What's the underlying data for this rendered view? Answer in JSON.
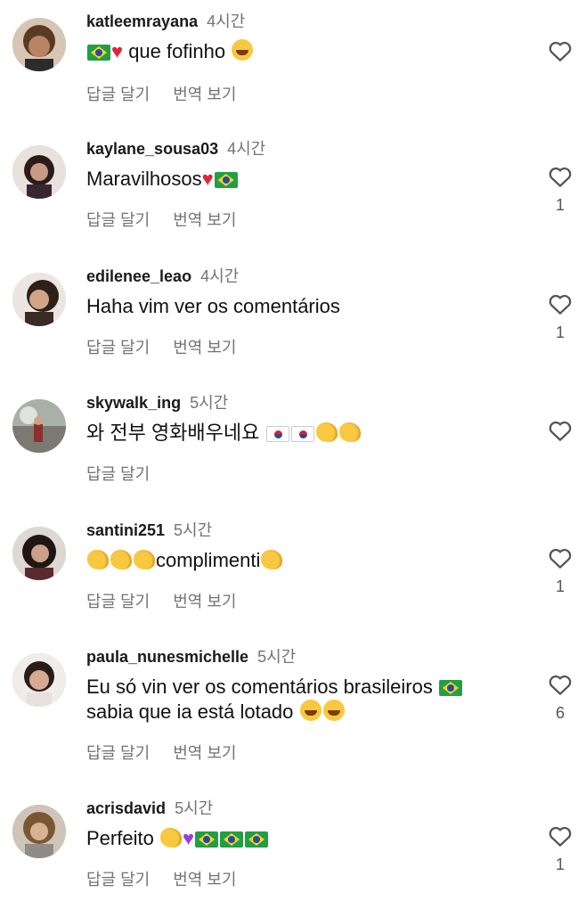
{
  "actions": {
    "reply": "답글 달기",
    "translate": "번역 보기"
  },
  "comments": [
    {
      "username": "katleemrayana",
      "time": "4시간",
      "text": "que fofinho",
      "likes": ""
    },
    {
      "username": "kaylane_sousa03",
      "time": "4시간",
      "text": "Maravilhosos",
      "likes": "1"
    },
    {
      "username": "edilenee_leao",
      "time": "4시간",
      "text": "Haha vim ver os comentários",
      "likes": "1"
    },
    {
      "username": "skywalk_ing",
      "time": "5시간",
      "text": "와 전부 영화배우네요",
      "likes": ""
    },
    {
      "username": "santini251",
      "time": "5시간",
      "text": "complimenti",
      "likes": "1"
    },
    {
      "username": "paula_nunesmichelle",
      "time": "5시간",
      "text_line1": "Eu só vin ver os comentários brasileiros",
      "text_line2": "sabia que ia está lotado",
      "likes": "6"
    },
    {
      "username": "acrisdavid",
      "time": "5시간",
      "text": "Perfeito",
      "likes": "1"
    }
  ],
  "colors": {
    "username": "#1a1a1a",
    "muted": "#737373",
    "heart": "#e0243a"
  },
  "icons": [
    "heart-outline-icon",
    "flag-brazil-emoji",
    "flag-korea-emoji",
    "clapping-hands-emoji",
    "red-heart-emoji",
    "purple-heart-emoji",
    "smiling-hearts-face-emoji",
    "laughing-face-emoji"
  ]
}
